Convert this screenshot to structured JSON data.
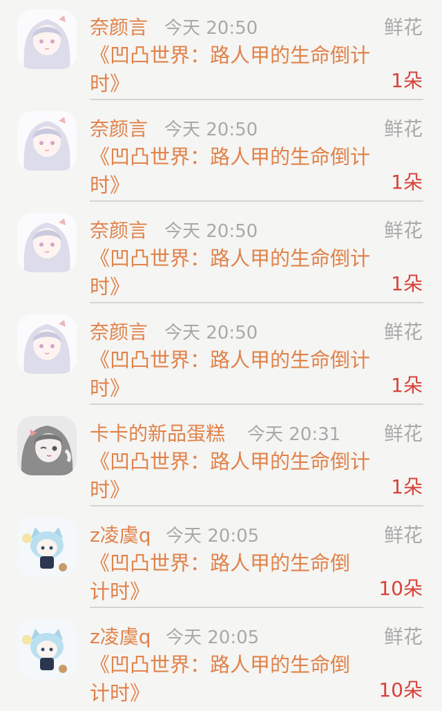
{
  "gift_records": [
    {
      "user": "奈颜言",
      "time": "今天 20:50",
      "gift": "鲜花",
      "book": "《凹凸世界：路人甲的生命倒计时》",
      "count": "1朵",
      "avatar_icon": "anime-girl-white-hair-avatar"
    },
    {
      "user": "奈颜言",
      "time": "今天 20:50",
      "gift": "鲜花",
      "book": "《凹凸世界：路人甲的生命倒计时》",
      "count": "1朵",
      "avatar_icon": "anime-girl-white-hair-avatar"
    },
    {
      "user": "奈颜言",
      "time": "今天 20:50",
      "gift": "鲜花",
      "book": "《凹凸世界：路人甲的生命倒计时》",
      "count": "1朵",
      "avatar_icon": "anime-girl-white-hair-avatar"
    },
    {
      "user": "奈颜言",
      "time": "今天 20:50",
      "gift": "鲜花",
      "book": "《凹凸世界：路人甲的生命倒计时》",
      "count": "1朵",
      "avatar_icon": "anime-girl-white-hair-avatar"
    },
    {
      "user": "卡卡的新品蛋糕",
      "time": "今天 20:31",
      "gift": "鲜花",
      "book": "《凹凸世界：路人甲的生命倒计时》",
      "count": "1朵",
      "avatar_icon": "anime-girl-winking-avatar"
    },
    {
      "user": "z凌虞q",
      "time": "今天 20:05",
      "gift": "鲜花",
      "book": "《凹凸世界：路人甲的生命倒计时》",
      "count": "10朵",
      "avatar_icon": "chibi-catgirl-avatar"
    },
    {
      "user": "z凌虞q",
      "time": "今天 20:05",
      "gift": "鲜花",
      "book": "《凹凸世界：路人甲的生命倒计时》",
      "count": "10朵",
      "avatar_icon": "chibi-catgirl-avatar"
    }
  ],
  "colors": {
    "accent_orange": "#e0824a",
    "count_red": "#d7423a",
    "muted_gray": "#a9a9a9",
    "background": "#f5f5f3",
    "divider": "#d4d4d2"
  }
}
